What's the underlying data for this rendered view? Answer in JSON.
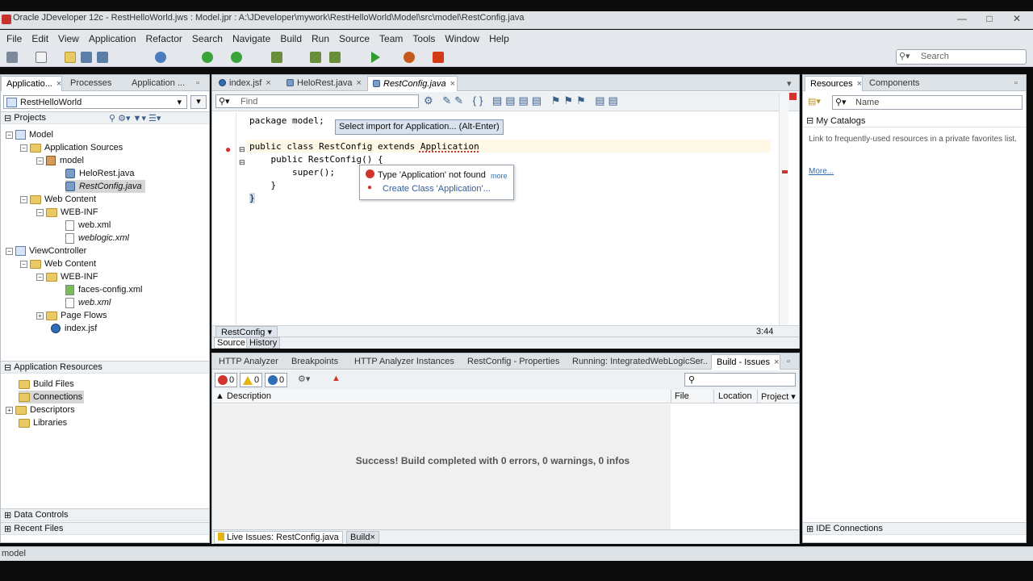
{
  "window": {
    "title": "Oracle JDeveloper 12c - RestHelloWorld.jws : Model.jpr : A:\\JDeveloper\\mywork\\RestHelloWorld\\Model\\src\\model\\RestConfig.java"
  },
  "menu": [
    "File",
    "Edit",
    "View",
    "Application",
    "Refactor",
    "Search",
    "Navigate",
    "Build",
    "Run",
    "Source",
    "Team",
    "Tools",
    "Window",
    "Help"
  ],
  "toolbar": {
    "search_placeholder": "Search"
  },
  "left_panel": {
    "tabs": [
      "Applicatio...",
      "Processes",
      "Application ..."
    ],
    "app_selector": "RestHelloWorld",
    "projects_label": "Projects",
    "tree": [
      {
        "label": "Model"
      },
      {
        "label": "Application Sources"
      },
      {
        "label": "model"
      },
      {
        "label": "HeloRest.java"
      },
      {
        "label": "RestConfig.java"
      },
      {
        "label": "Web Content"
      },
      {
        "label": "WEB-INF"
      },
      {
        "label": "web.xml"
      },
      {
        "label": "weblogic.xml"
      },
      {
        "label": "ViewController"
      },
      {
        "label": "Web Content"
      },
      {
        "label": "WEB-INF"
      },
      {
        "label": "faces-config.xml"
      },
      {
        "label": "web.xml"
      },
      {
        "label": "Page Flows"
      },
      {
        "label": "index.jsf"
      }
    ],
    "app_resources_label": "Application Resources",
    "app_resources": [
      "Build Files",
      "Connections",
      "Descriptors",
      "Libraries"
    ],
    "data_controls_label": "Data Controls",
    "recent_files_label": "Recent Files"
  },
  "editor": {
    "tabs": [
      "index.jsf",
      "HeloRest.java",
      "RestConfig.java"
    ],
    "find_placeholder": "Find",
    "code_lines": [
      "package model;",
      "public class RestConfig extends Application",
      "    public RestConfig() {",
      "        super();",
      "    }",
      "}"
    ],
    "import_hint": "Select import for Application... (Alt-Enter)",
    "popup": {
      "error": "Type 'Application' not found",
      "more": "more",
      "fix": "Create Class 'Application'..."
    },
    "breadcrumb": "RestConfig",
    "position": "3:44",
    "bottom_tabs": [
      "Source",
      "History"
    ]
  },
  "log_panel": {
    "tabs": [
      "HTTP Analyzer",
      "Breakpoints",
      "HTTP Analyzer Instances",
      "RestConfig - Properties",
      "Running: IntegratedWebLogicSer...",
      "Build - Issues"
    ],
    "counters": {
      "errors": "0",
      "warnings": "0",
      "infos": "0"
    },
    "columns": [
      "Description",
      "File",
      "Location",
      "Project"
    ],
    "message": "Success!  Build completed with 0 errors, 0 warnings, 0 infos",
    "bottom_tabs": [
      "Live Issues: RestConfig.java",
      "Build"
    ]
  },
  "right_panel": {
    "tabs": [
      "Resources",
      "Components"
    ],
    "name_placeholder": "Name",
    "my_catalogs_label": "My Catalogs",
    "catalog_text": "Link to frequently-used resources in a private favorites list.",
    "more_link": "More...",
    "ide_connections_label": "IDE Connections"
  },
  "status_bar": {
    "text": "model"
  },
  "colors": {
    "accent": "#2f6db5",
    "error": "#d0342c",
    "warning": "#e7b416",
    "info": "#2f6db5",
    "panel_bg": "#ffffff",
    "chrome_bg": "#e4e8ec"
  }
}
